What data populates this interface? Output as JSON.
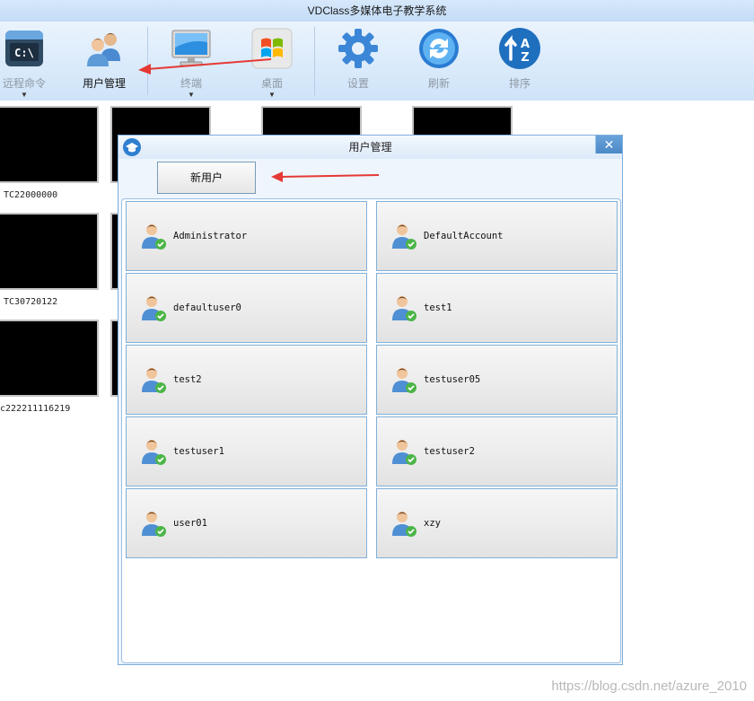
{
  "window": {
    "title": "VDClass多媒体电子教学系统"
  },
  "toolbar": {
    "items": [
      {
        "label": "远程命令",
        "icon": "cmd-terminal-icon",
        "dropdown": true
      },
      {
        "label": "用户管理",
        "icon": "users-icon",
        "dropdown": false,
        "active": true
      },
      {
        "label": "终端",
        "icon": "monitor-icon",
        "dropdown": true
      },
      {
        "label": "桌面",
        "icon": "windows-desktop-icon",
        "dropdown": true
      },
      {
        "label": "设置",
        "icon": "gear-icon",
        "dropdown": false
      },
      {
        "label": "刷新",
        "icon": "refresh-icon",
        "dropdown": false
      },
      {
        "label": "排序",
        "icon": "sort-az-icon",
        "dropdown": false
      }
    ]
  },
  "terminals": [
    {
      "name": "TC22000000"
    },
    {
      "name": "TC30720122"
    },
    {
      "name": "c222211116219"
    }
  ],
  "dialog": {
    "title": "用户管理",
    "new_user_button": "新用户",
    "users": [
      "Administrator",
      "DefaultAccount",
      "defaultuser0",
      "test1",
      "test2",
      "testuser05",
      "testuser1",
      "testuser2",
      "user01",
      "xzy"
    ]
  },
  "watermark": "https://blog.csdn.net/azure_2010",
  "colors": {
    "accent": "#3b86d6",
    "arrow": "#e53935",
    "tile": "#000000"
  }
}
